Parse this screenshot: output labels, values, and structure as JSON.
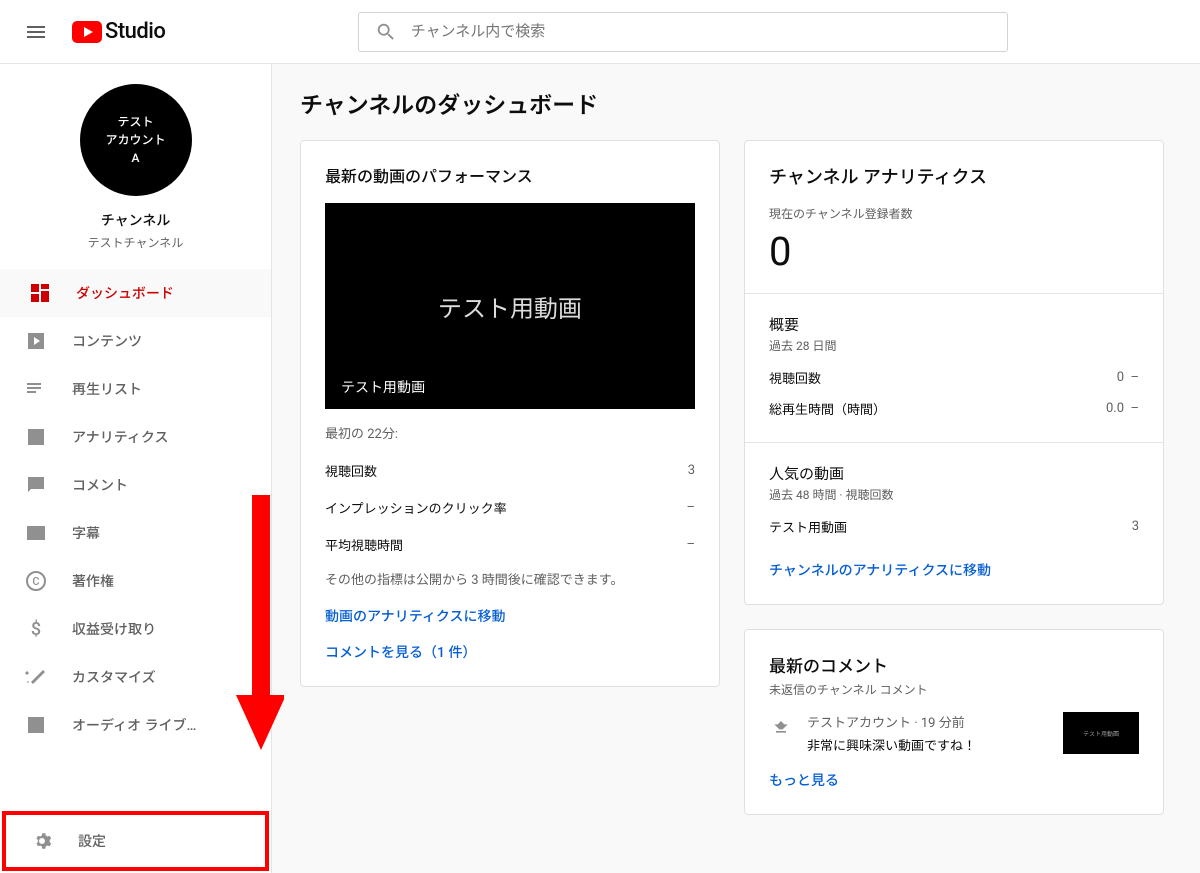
{
  "header": {
    "logo_text": "Studio",
    "search_placeholder": "チャンネル内で検索"
  },
  "sidebar": {
    "avatar_line1": "テスト",
    "avatar_line2": "アカウント",
    "avatar_line3": "A",
    "channel_label": "チャンネル",
    "channel_name": "テストチャンネル",
    "items": [
      {
        "label": "ダッシュボード",
        "icon": "dashboard-icon",
        "active": true
      },
      {
        "label": "コンテンツ",
        "icon": "content-icon"
      },
      {
        "label": "再生リスト",
        "icon": "playlist-icon"
      },
      {
        "label": "アナリティクス",
        "icon": "analytics-icon"
      },
      {
        "label": "コメント",
        "icon": "comment-icon"
      },
      {
        "label": "字幕",
        "icon": "subtitles-icon"
      },
      {
        "label": "著作権",
        "icon": "copyright-icon"
      },
      {
        "label": "収益受け取り",
        "icon": "monetization-icon"
      },
      {
        "label": "カスタマイズ",
        "icon": "customize-icon"
      },
      {
        "label": "オーディオ ライブ…",
        "icon": "audio-icon"
      }
    ],
    "settings_label": "設定"
  },
  "main": {
    "title": "チャンネルのダッシュボード"
  },
  "latest_video": {
    "title": "最新の動画のパフォーマンス",
    "thumb_center": "テスト用動画",
    "thumb_bottom": "テスト用動画",
    "first_note": "最初の 22分:",
    "metrics": [
      {
        "label": "視聴回数",
        "value": "3"
      },
      {
        "label": "インプレッションのクリック率",
        "value": "–"
      },
      {
        "label": "平均視聴時間",
        "value": "–"
      }
    ],
    "footnote": "その他の指標は公開から 3 時間後に確認できます。",
    "link_analytics": "動画のアナリティクスに移動",
    "link_comments": "コメントを見る（1 件）"
  },
  "analytics": {
    "title": "チャンネル アナリティクス",
    "subscriber_label": "現在のチャンネル登録者数",
    "subscriber_count": "0",
    "overview_label": "概要",
    "overview_period": "過去 28 日間",
    "rows": [
      {
        "label": "視聴回数",
        "value": "0",
        "delta": "–"
      },
      {
        "label": "総再生時間（時間）",
        "value": "0.0",
        "delta": "–"
      }
    ],
    "popular_label": "人気の動画",
    "popular_period": "過去 48 時間 · 視聴回数",
    "popular_rows": [
      {
        "label": "テスト用動画",
        "value": "3"
      }
    ],
    "link": "チャンネルのアナリティクスに移動"
  },
  "comments": {
    "title": "最新のコメント",
    "sub": "未返信のチャンネル コメント",
    "author": "テストアカウント",
    "time": "19 分前",
    "text": "非常に興味深い動画ですね！",
    "thumb_label": "テスト用動画",
    "more": "もっと見る"
  }
}
